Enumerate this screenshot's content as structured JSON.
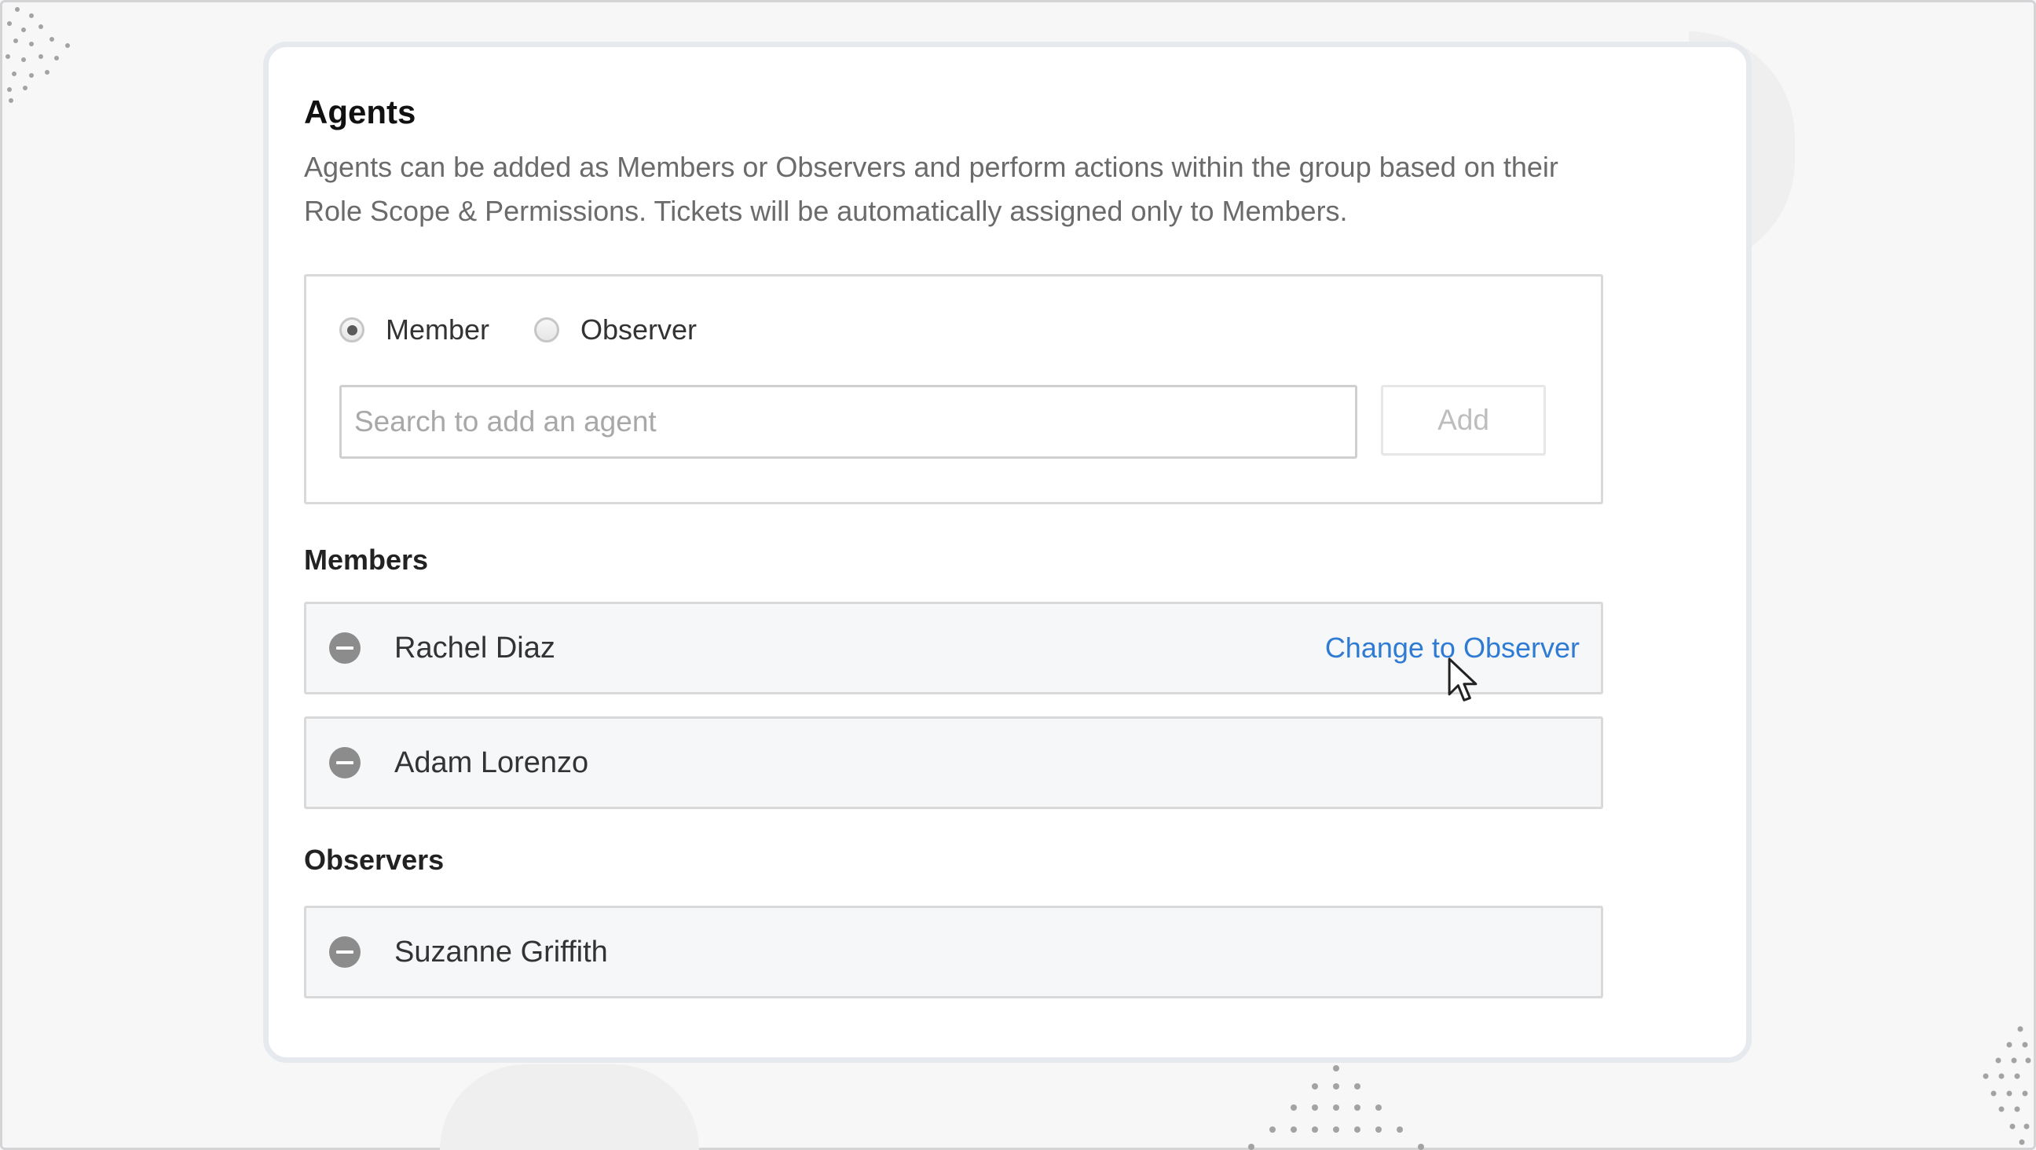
{
  "agents_section": {
    "title": "Agents",
    "description": "Agents can be added as Members or Observers and perform actions within the group based on their Role Scope & Permissions. Tickets will be automatically assigned only to Members.",
    "role_options": {
      "member_label": "Member",
      "observer_label": "Observer",
      "selected": "Member"
    },
    "search": {
      "placeholder": "Search to add an agent",
      "value": ""
    },
    "add_label": "Add"
  },
  "members": {
    "heading": "Members",
    "items": [
      {
        "name": "Rachel Diaz",
        "action_label": "Change to Observer"
      },
      {
        "name": "Adam Lorenzo"
      }
    ]
  },
  "observers": {
    "heading": "Observers",
    "items": [
      {
        "name": "Suzanne Griffith"
      }
    ]
  },
  "icons": {
    "remove": "minus-circle-icon",
    "cursor": "mouse-pointer-icon"
  },
  "colors": {
    "link": "#2f7bd3",
    "remove_icon": "#8c8c8c",
    "row_background": "#f5f7f9"
  }
}
